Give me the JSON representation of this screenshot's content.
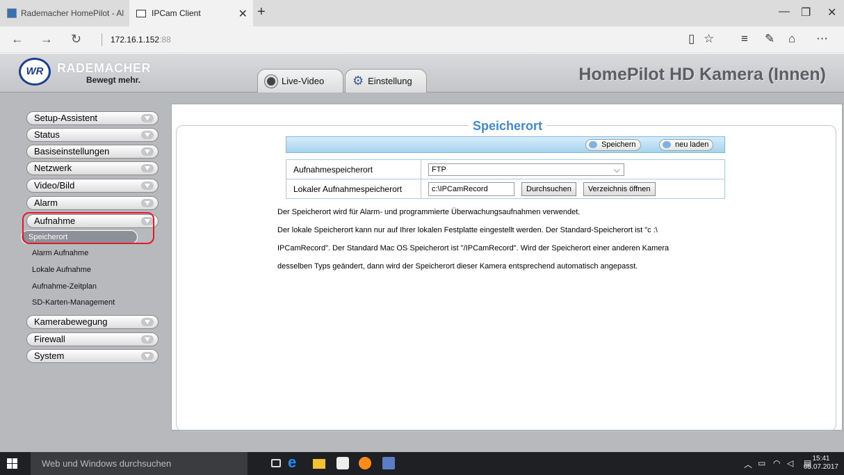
{
  "browser": {
    "tabs": [
      {
        "label": "Rademacher HomePilot - Al"
      },
      {
        "label": "IPCam Client"
      }
    ],
    "url_host": "172.16.1.152",
    "url_port": ":88"
  },
  "header": {
    "brand": "RADEMACHER",
    "tagline": "Bewegt mehr.",
    "title": "HomePilot HD Kamera (Innen)",
    "tabs": [
      {
        "label": "Live-Video"
      },
      {
        "label": "Einstellung"
      }
    ]
  },
  "sidebar": {
    "menus": [
      {
        "label": "Setup-Assistent"
      },
      {
        "label": "Status"
      },
      {
        "label": "Basiseinstellungen"
      },
      {
        "label": "Netzwerk"
      },
      {
        "label": "Video/Bild"
      },
      {
        "label": "Alarm"
      },
      {
        "label": "Aufnahme"
      },
      {
        "label": "Kamerabewegung"
      },
      {
        "label": "Firewall"
      },
      {
        "label": "System"
      }
    ],
    "submenu": [
      {
        "label": "Speicherort"
      },
      {
        "label": "Alarm Aufnahme"
      },
      {
        "label": "Lokale Aufnahme"
      },
      {
        "label": "Aufnahme-Zeitplan"
      },
      {
        "label": "SD-Karten-Management"
      }
    ]
  },
  "main": {
    "title": "Speicherort",
    "save_label": "Speichern",
    "reload_label": "neu laden",
    "row1_label": "Aufnahmespeicherort",
    "row1_value": "FTP",
    "row2_label": "Lokaler Aufnahmespeicherort",
    "row2_value": "c:\\IPCamRecord",
    "browse_label": "Durchsuchen",
    "open_label": "Verzeichnis öffnen",
    "desc": [
      "Der Speicherort wird für Alarm- und programmierte Überwachungsaufnahmen verwendet.",
      "Der lokale Speicherort kann nur auf Ihrer lokalen Festplatte eingestellt werden. Der Standard-Speicherort ist \"c :\\",
      "IPCamRecord\". Der Standard Mac OS Speicherort ist \"/IPCamRecord\". Wird der Speicherort einer anderen Kamera",
      "desselben Typs geändert, dann wird der Speicherort dieser Kamera entsprechend automatisch angepasst."
    ]
  },
  "taskbar": {
    "search_placeholder": "Web und Windows durchsuchen",
    "time": "15:41",
    "date": "05.07.2017"
  },
  "colors": {
    "accent": "#3f8ad0",
    "highlight": "#e0192c"
  }
}
